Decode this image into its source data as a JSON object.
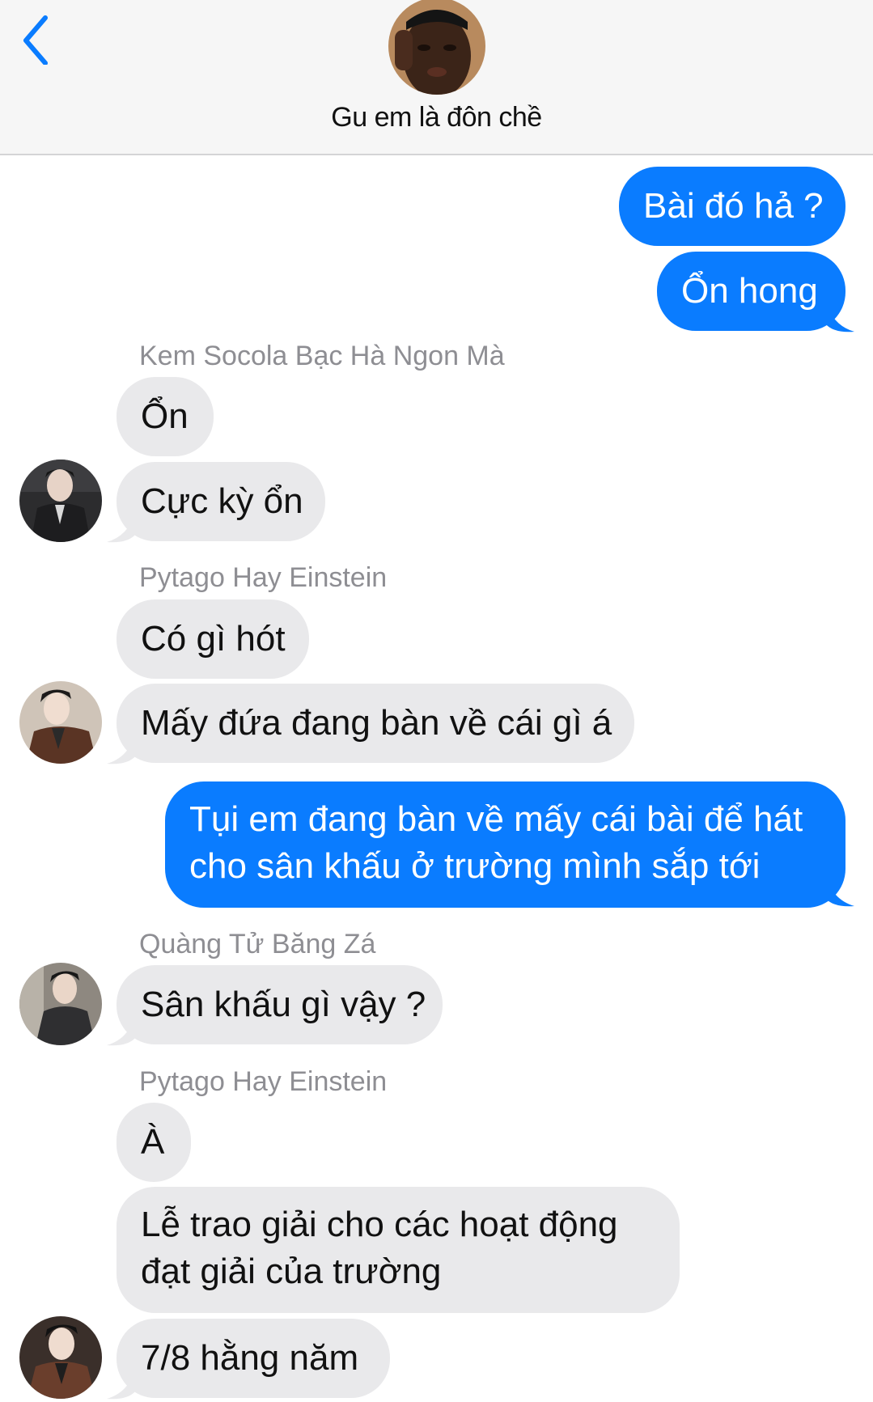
{
  "header": {
    "back_icon": "chevron-left-icon",
    "group_avatar_icon": "group-avatar-icon",
    "title": "Gu em là đôn chề"
  },
  "colors": {
    "outgoing": "#0a7cff",
    "incoming": "#e9e9eb",
    "accent": "#0a7cff"
  },
  "messages": {
    "out1": "Bài đó hả ?",
    "out2": "Ổn hong",
    "sender1": "Kem Socola Bạc Hà Ngon Mà",
    "in1": "Ổn",
    "in2": "Cực kỳ ổn",
    "sender2": "Pytago Hay Einstein",
    "in3": "Có gì hót",
    "in4": "Mấy đứa đang bàn về cái gì á",
    "out3_line1": "Tụi em đang bàn về mấy cái bài để hát",
    "out3_line2": "cho sân khấu ở trường mình sắp tới",
    "sender3": "Quàng Tử Băng Zá",
    "in5": "Sân khấu gì vậy ?",
    "sender4": "Pytago Hay Einstein",
    "in6": "À",
    "in7_line1": "Lễ trao giải cho các hoạt động",
    "in7_line2": "đạt giải của trường",
    "in8": "7/8 hằng năm"
  }
}
